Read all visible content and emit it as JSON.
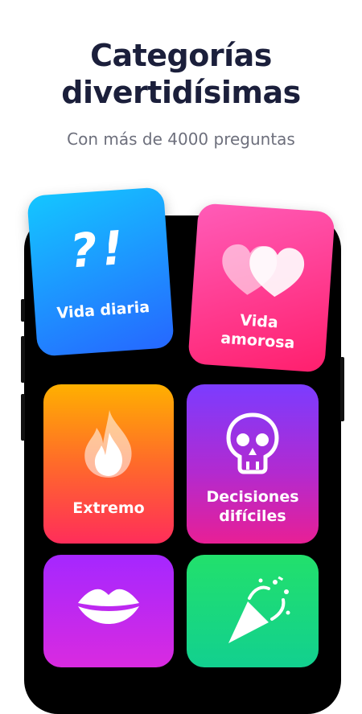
{
  "header": {
    "title_line1": "Categorías",
    "title_line2": "divertidísimas",
    "subtitle": "Con más de 4000 preguntas"
  },
  "categories": [
    {
      "label": "Vida diaria",
      "icon": "question-exclamation-icon",
      "gradient": [
        "#13c3ff",
        "#1f5dff"
      ],
      "glyph": "?!"
    },
    {
      "label_line1": "Vida",
      "label_line2": "amorosa",
      "icon": "hearts-icon",
      "gradient": [
        "#ff4fb3",
        "#ff1e6e"
      ]
    },
    {
      "label": "Extremo",
      "icon": "flame-icon",
      "gradient": [
        "#ffb000",
        "#ff2d5a"
      ]
    },
    {
      "label_line1": "Decisiones",
      "label_line2": "difíciles",
      "icon": "skull-icon",
      "gradient": [
        "#8a3dff",
        "#e4209a"
      ]
    },
    {
      "label": "",
      "icon": "lips-icon",
      "gradient": [
        "#b126ff",
        "#e42ad6"
      ]
    },
    {
      "label": "",
      "icon": "party-popper-icon",
      "gradient": [
        "#20e070",
        "#11cf9a"
      ]
    }
  ],
  "colors": {
    "title": "#1b1f3b",
    "subtitle": "#6d6f7c",
    "phone": "#000000"
  }
}
